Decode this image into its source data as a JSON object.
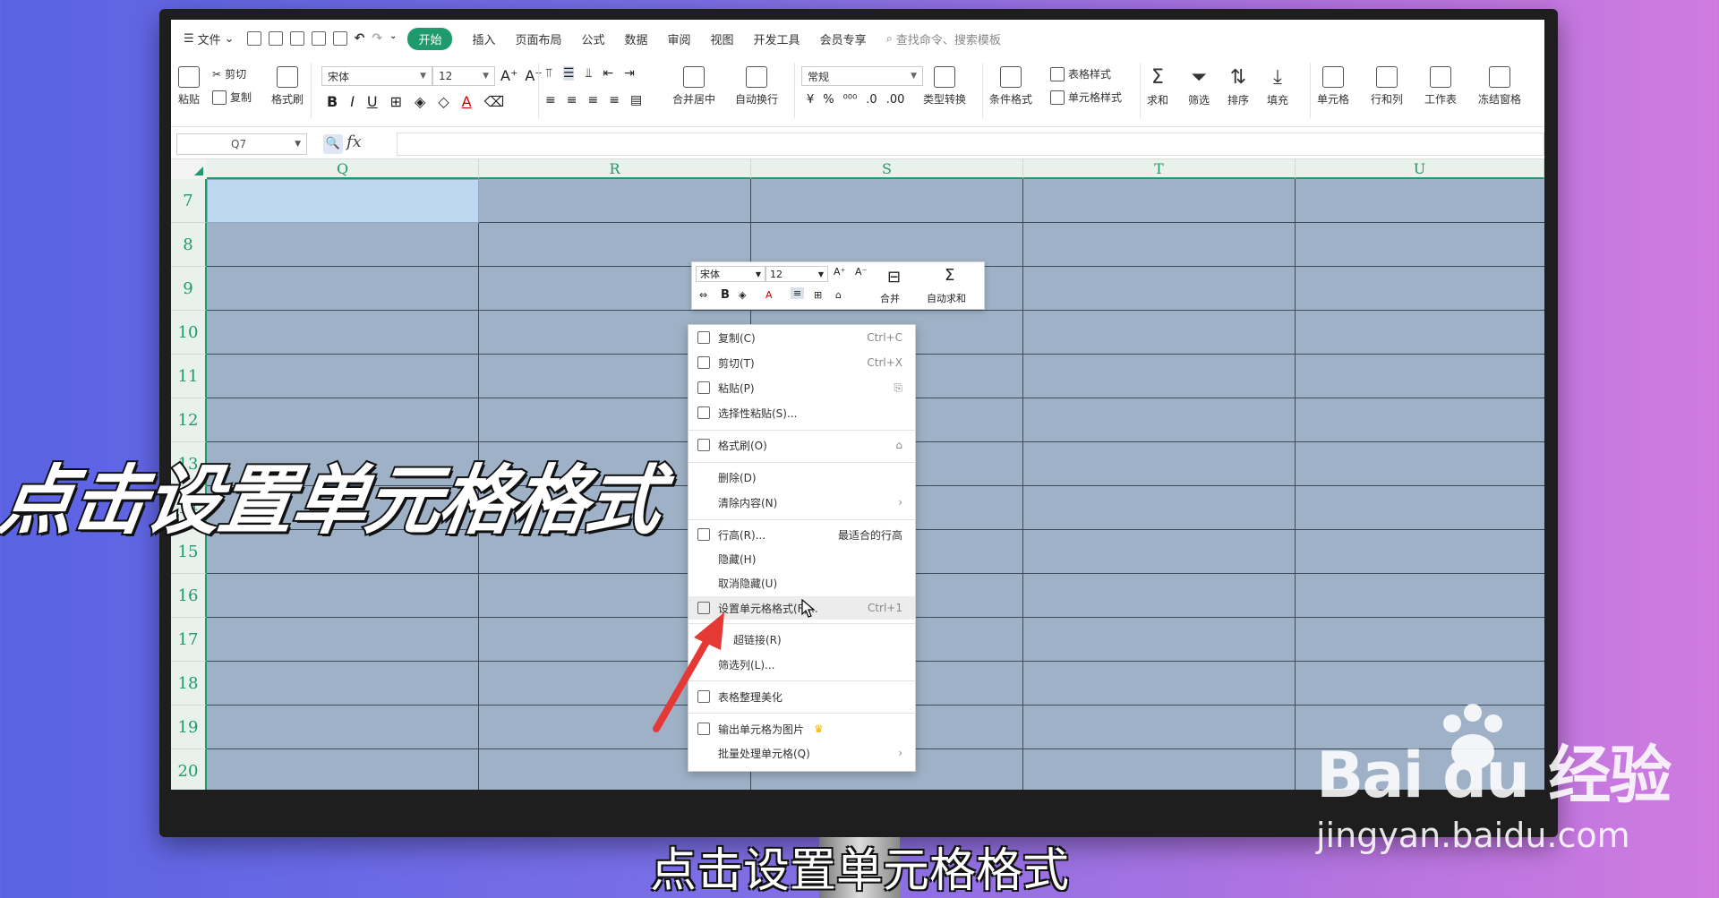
{
  "menubar": {
    "file": "文件",
    "tabs": [
      "开始",
      "插入",
      "页面布局",
      "公式",
      "数据",
      "审阅",
      "视图",
      "开发工具",
      "会员专享"
    ],
    "search_placeholder": "查找命令、搜索模板"
  },
  "ribbon": {
    "paste": "粘贴",
    "cut": "剪切",
    "copy": "复制",
    "format_painter": "格式刷",
    "font_name": "宋体",
    "font_size": "12",
    "merge_center": "合并居中",
    "wrap_text": "自动换行",
    "number_format": "常规",
    "type_convert": "类型转换",
    "conditional_format": "条件格式",
    "table_style": "表格样式",
    "cell_style": "单元格样式",
    "sum": "求和",
    "filter": "筛选",
    "sort": "排序",
    "fill": "填充",
    "cell": "单元格",
    "row_col": "行和列",
    "worksheet": "工作表",
    "freeze": "冻结窗格"
  },
  "formula_bar": {
    "name_box": "Q7",
    "fx": "fx"
  },
  "grid": {
    "columns": [
      "Q",
      "R",
      "S",
      "T",
      "U"
    ],
    "rows": [
      "7",
      "8",
      "9",
      "10",
      "11",
      "12",
      "13",
      "14",
      "15",
      "16",
      "17",
      "18",
      "19",
      "20"
    ]
  },
  "mini_toolbar": {
    "font": "宋体",
    "size": "12",
    "merge": "合并",
    "autosum": "自动求和"
  },
  "context_menu": {
    "copy": "复制(C)",
    "copy_sc": "Ctrl+C",
    "cut": "剪切(T)",
    "cut_sc": "Ctrl+X",
    "paste": "粘贴(P)",
    "paste_special": "选择性粘贴(S)...",
    "format_painter": "格式刷(O)",
    "delete": "删除(D)",
    "clear": "清除内容(N)",
    "row_height": "行高(R)...",
    "best_fit": "最适合的行高",
    "hide": "隐藏(H)",
    "unhide": "取消隐藏(U)",
    "format_cells": "设置单元格格式(F)...",
    "format_cells_sc": "Ctrl+1",
    "hyperlink": "超链接(R)",
    "filter_col": "筛选列(L)...",
    "beautify": "表格整理美化",
    "export_image": "输出单元格为图片",
    "batch": "批量处理单元格(Q)"
  },
  "overlay": {
    "big_title": "点击设置单元格格式",
    "subtitle": "点击设置单元格格式",
    "watermark": "Bai du 经验",
    "watermark_url": "jingyan.baidu.com"
  },
  "colors": {
    "accent": "#1f9a6d",
    "selection": "#9eb1c6",
    "arrow": "#e53935"
  }
}
